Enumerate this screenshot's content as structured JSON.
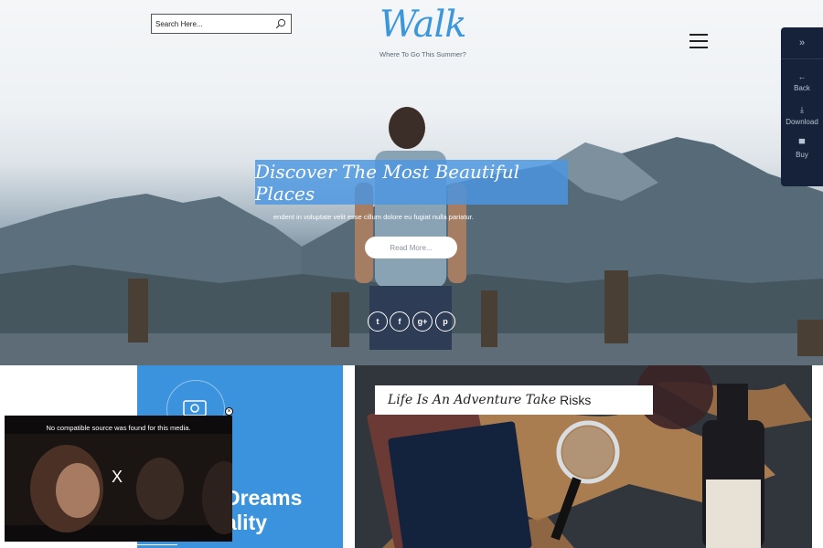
{
  "header": {
    "search": {
      "placeholder": "Search Here..."
    },
    "logo": "Walk",
    "tagline": "Where To Go This Summer?"
  },
  "side_panel": {
    "items": [
      {
        "label": "Back",
        "icon": "arrow-left-icon"
      },
      {
        "label": "Download",
        "icon": "download-icon"
      },
      {
        "label": "Buy",
        "icon": "cart-icon"
      }
    ]
  },
  "hero": {
    "title": "Discover The Most Beautiful Places",
    "text": "endent in voluptate velit esse cillum dolore eu fugiat nulla pariatur.",
    "read_more": "Read More...",
    "social": [
      "twitter-icon",
      "facebook-icon",
      "google-plus-icon",
      "pinterest-icon"
    ]
  },
  "cards": {
    "blue_card": {
      "title_line1": "Dreams",
      "title_line2": "ality"
    },
    "map_card": {
      "title_script": "Life Is An Adventure Take",
      "title_plain": "Risks"
    }
  },
  "video_popup": {
    "message": "No compatible source was found for this media.",
    "x_label": "X",
    "close_label": "×"
  },
  "colors": {
    "accent": "#3a93dc",
    "panel": "#16223a",
    "logo": "#3a97db"
  }
}
